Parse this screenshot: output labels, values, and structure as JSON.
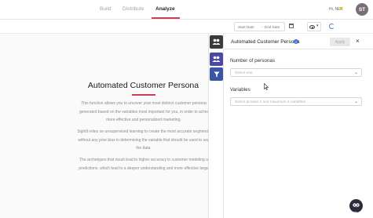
{
  "nav": {
    "tabs": [
      {
        "label": "Build"
      },
      {
        "label": "Distribute"
      },
      {
        "label": "Analyze"
      }
    ],
    "active_tab": "Analyze",
    "user_name": "Hi, NEX",
    "avatar_initials": "ST"
  },
  "toolbar": {
    "start_date_placeholder": "Start Date",
    "arrow": "→",
    "end_date_placeholder": "End Date"
  },
  "background": {
    "title": "Automated Customer Persona",
    "paragraphs": [
      [
        "This function allows you to uncover your most distinct customer persona",
        "generated based on the variables most important for you, in order to achie",
        "more effective and personalized marketing."
      ],
      [
        "Sightll relies on unsupervised learning to create the most accurate segmenta",
        "without any prior bias in determining the variable that should be used to seg",
        "the data."
      ],
      [
        "The archetypes that result lead to higher accuracy in customer modeling a",
        "predictions, which lead to a deeper understanding and more effective targe"
      ]
    ]
  },
  "panel": {
    "title": "Automated Customer Persona",
    "apply_label": "Apply",
    "close_glyph": "×",
    "num_personas_label": "Number of personas",
    "num_personas_placeholder": "Select one",
    "variables_label": "Variables",
    "variables_placeholder": "Select at least 2 and maximum 5 variables"
  },
  "help": {
    "label": "Help"
  },
  "colors": {
    "accent": "#d23c4f",
    "strip_dark": "#3b3b3b",
    "strip_purple": "#4a49a6",
    "strip_blue": "#3a55a6",
    "info_blue": "#3b6fd4"
  }
}
